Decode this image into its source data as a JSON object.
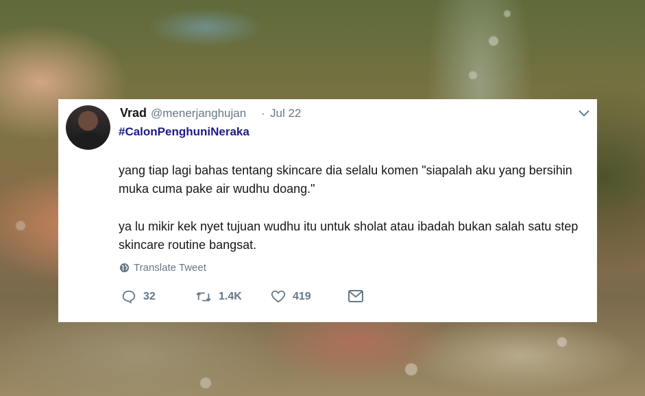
{
  "tweet": {
    "display_name": "Vrad",
    "handle": "@menerjanghujan",
    "separator": "·",
    "date": "Jul 22",
    "hashtag": "#CalonPenghuniNeraka",
    "paragraph_1": "yang tiap lagi bahas tentang skincare dia selalu komen \"siapalah aku yang bersihin muka cuma pake air wudhu doang.\"",
    "paragraph_2": "ya lu mikir kek nyet tujuan wudhu itu untuk sholat atau ibadah bukan salah satu step skincare routine bangsat.",
    "translate_label": "Translate Tweet",
    "replies": "32",
    "retweets": "1.4K",
    "likes": "419"
  },
  "icons": {
    "chevron": "chevron-down-icon",
    "globe": "globe-icon",
    "reply": "reply-icon",
    "retweet": "retweet-icon",
    "like": "heart-icon",
    "dm": "envelope-icon"
  },
  "colors": {
    "hashtag": "#1b1b87",
    "muted": "#657786",
    "text": "#14171a",
    "card": "#ffffff"
  }
}
